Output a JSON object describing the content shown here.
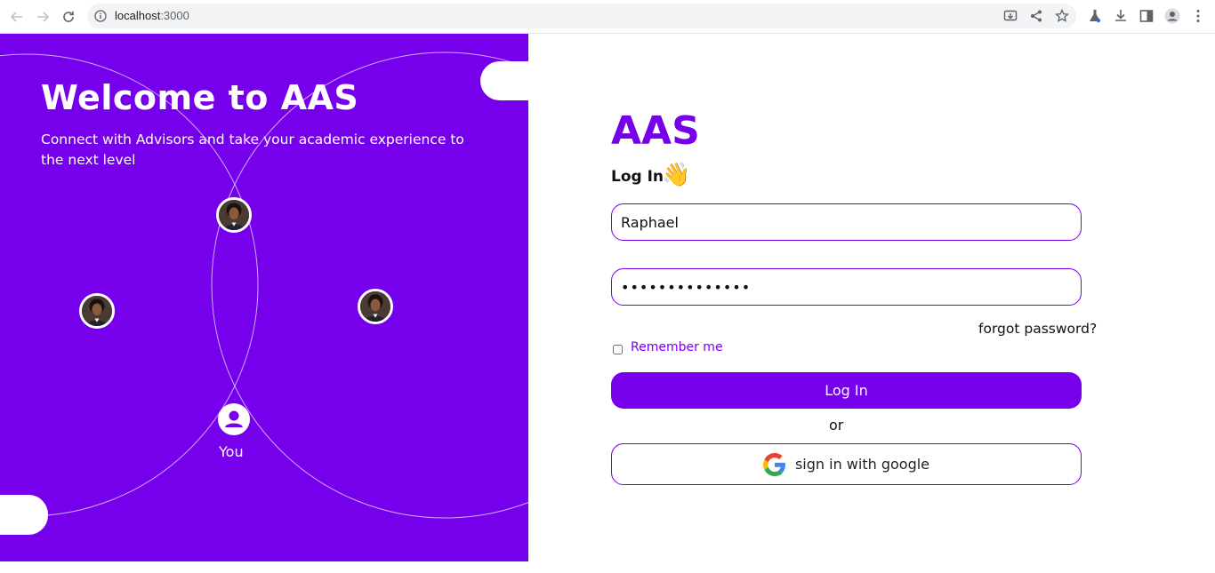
{
  "browser": {
    "url_host": "localhost",
    "url_port": ":3000"
  },
  "hero": {
    "title": "Welcome to AAS",
    "subtitle": "Connect with Advisors and take your academic experience to the next level",
    "you_label": "You"
  },
  "login": {
    "brand": "AAS",
    "heading": "Log In",
    "wave_emoji": "👋",
    "username_value": "Raphael",
    "password_value": "••••••••••••••",
    "forgot_label": "forgot password?",
    "remember_label": "Remember me",
    "login_button": "Log In",
    "or_label": "or",
    "google_button": "sign in with google"
  },
  "colors": {
    "brand_purple": "#7600eb",
    "white": "#ffffff"
  }
}
